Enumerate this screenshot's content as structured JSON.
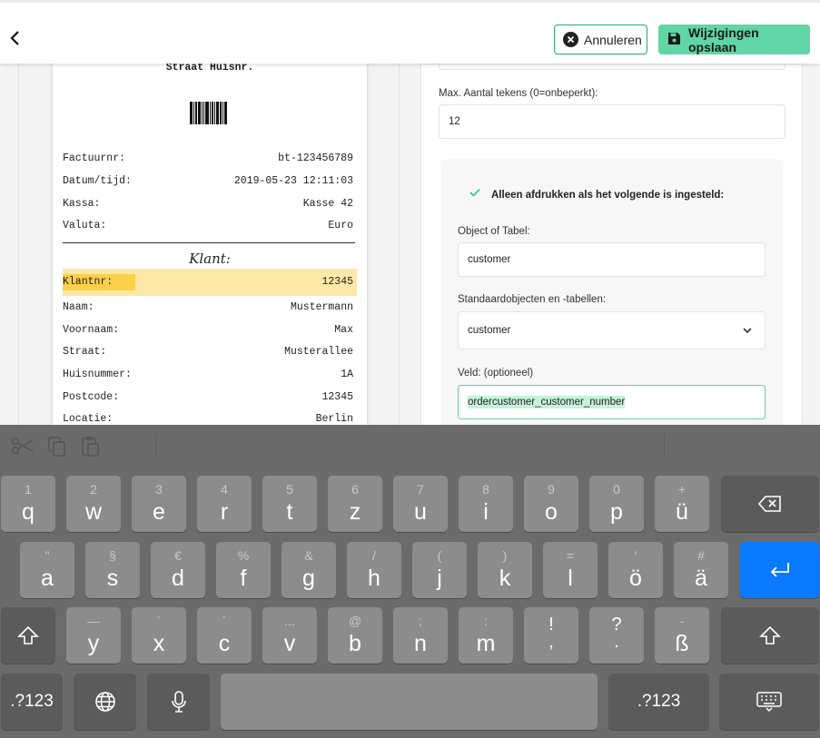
{
  "header": {
    "cancel_label": "Annuleren",
    "save_label": "Wijzigingen opslaan",
    "save_color": "#5fd6a3",
    "cancel_border": "#2aa876"
  },
  "receipt": {
    "street": "Straat Huisnr.",
    "rows_top": [
      {
        "label": "Factuurnr:",
        "value": "bt-123456789"
      },
      {
        "label": "Datum/tijd:",
        "value": "2019-05-23 12:11:03"
      },
      {
        "label": "Kassa:",
        "value": "Kasse 42"
      },
      {
        "label": "Valuta:",
        "value": "Euro"
      }
    ],
    "customer_heading": "Klant:",
    "highlight": {
      "label": "Klantnr:",
      "value": "12345"
    },
    "rows_bottom": [
      {
        "label": "Naam:",
        "value": "Mustermann"
      },
      {
        "label": "Voornaam:",
        "value": "Max"
      },
      {
        "label": "Straat:",
        "value": "Musterallee"
      },
      {
        "label": "Huisnummer:",
        "value": "1A"
      },
      {
        "label": "Postcode:",
        "value": "12345"
      },
      {
        "label": "Locatie:",
        "value": "Berlin"
      }
    ]
  },
  "form": {
    "max_chars_label": "Max. Aantal tekens (0=onbeperkt):",
    "max_chars_value": "12",
    "condition_title": "Alleen afdrukken als het volgende is ingesteld:",
    "object_label": "Object of Tabel:",
    "object_value": "customer",
    "standard_label": "Standaardobjecten en -tabellen:",
    "standard_value": "customer",
    "field_label": "Veld: (optioneel)",
    "field_value": "ordercustomer_customer_number"
  },
  "keyboard": {
    "row1": [
      {
        "alt": "1",
        "main": "q"
      },
      {
        "alt": "2",
        "main": "w"
      },
      {
        "alt": "3",
        "main": "e"
      },
      {
        "alt": "4",
        "main": "r"
      },
      {
        "alt": "5",
        "main": "t"
      },
      {
        "alt": "6",
        "main": "z"
      },
      {
        "alt": "7",
        "main": "u"
      },
      {
        "alt": "8",
        "main": "i"
      },
      {
        "alt": "9",
        "main": "o"
      },
      {
        "alt": "0",
        "main": "p"
      },
      {
        "alt": "+",
        "main": "ü"
      }
    ],
    "row2": [
      {
        "alt": "\"",
        "main": "a"
      },
      {
        "alt": "§",
        "main": "s"
      },
      {
        "alt": "€",
        "main": "d"
      },
      {
        "alt": "%",
        "main": "f"
      },
      {
        "alt": "&",
        "main": "g"
      },
      {
        "alt": "/",
        "main": "h"
      },
      {
        "alt": "(",
        "main": "j"
      },
      {
        "alt": ")",
        "main": "k"
      },
      {
        "alt": "=",
        "main": "l"
      },
      {
        "alt": "'",
        "main": "ö"
      },
      {
        "alt": "#",
        "main": "ä"
      }
    ],
    "row3": [
      {
        "alt": "—",
        "main": "y"
      },
      {
        "alt": "`",
        "main": "x"
      },
      {
        "alt": "´",
        "main": "c"
      },
      {
        "alt": "...",
        "main": "v"
      },
      {
        "alt": "@",
        "main": "b"
      },
      {
        "alt": ";",
        "main": "n"
      },
      {
        "alt": ":",
        "main": "m"
      }
    ],
    "punct": [
      {
        "top": "!",
        "bottom": ","
      },
      {
        "top": "?",
        "bottom": "."
      },
      {
        "alt": "-",
        "main": "ß"
      }
    ],
    "numbers_label": ".?123",
    "return_color": "#0a7aff"
  }
}
